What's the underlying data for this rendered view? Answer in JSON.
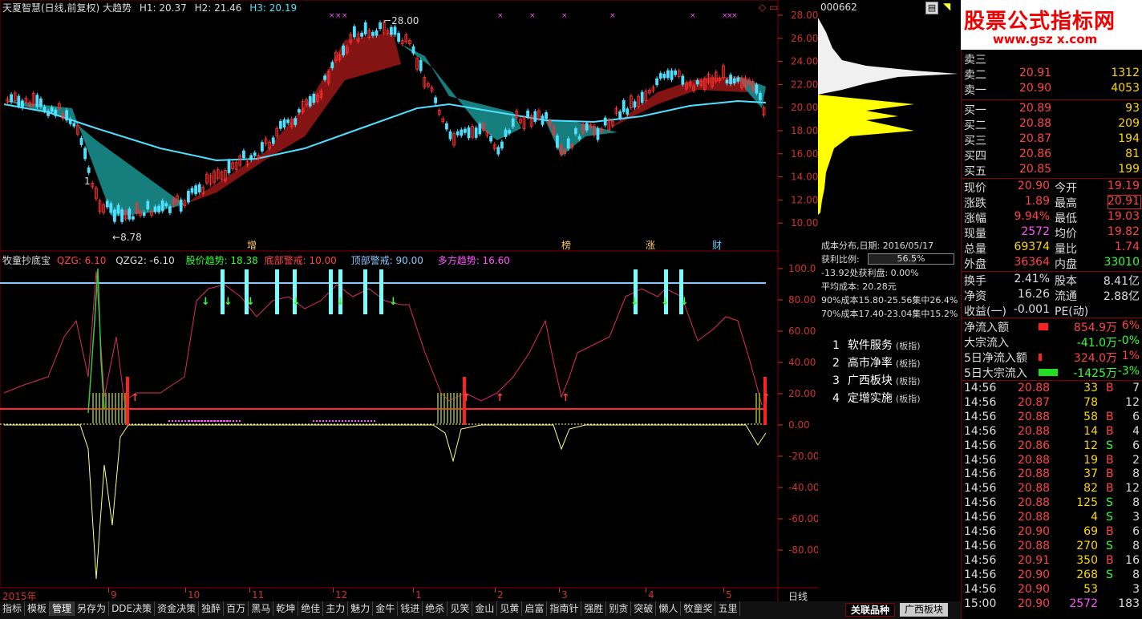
{
  "header": {
    "stock": "天夏智慧(日线,前复权)",
    "indicator": "大趋势",
    "h1": "H1: 20.37",
    "h2": "H2: 21.46",
    "h3": "H3: 20.19",
    "code": "000662"
  },
  "sub_header": {
    "name": "牧童抄底宝",
    "qzg": "QZG: 6.10",
    "qzg2": "QZG2: -6.10",
    "trend": "股价趋势: 18.38",
    "bottom": "底部警戒: 10.00",
    "top": "顶部警戒: 90.00",
    "multi": "多方趋势: 16.60"
  },
  "price_axis": [
    "28.00",
    "26.00",
    "24.00",
    "22.00",
    "20.00",
    "18.00",
    "16.00",
    "14.00",
    "12.00",
    "10.00"
  ],
  "ind_axis": [
    "100.0",
    "80.00",
    "60.00",
    "40.00",
    "20.00",
    "0.00",
    "-20.00",
    "-40.00",
    "-60.00",
    "-80.00"
  ],
  "annotations": {
    "high": "28.00",
    "low": "8.78",
    "marks": [
      "增",
      "榜",
      "涨",
      "财"
    ]
  },
  "time_axis": {
    "labels": [
      "2015年",
      "9",
      "10",
      "11",
      "12",
      "1",
      "2",
      "3",
      "4",
      "5"
    ],
    "period": "日线"
  },
  "cost": {
    "title": "成本分布,日期: 2016/05/17",
    "profit_label": "获利比例:",
    "profit_value": "56.5%",
    "line1": "-13.92处获利盘: 0.00%",
    "line2": "平均成本: 20.28元",
    "line3": "90%成本15.80-25.56集中26.4%",
    "line4": "70%成本17.40-23.04集中15.2%"
  },
  "sectors": [
    {
      "n": "1",
      "name": "软件服务",
      "tag": "(板指)"
    },
    {
      "n": "2",
      "name": "高市净率",
      "tag": "(板指)"
    },
    {
      "n": "3",
      "name": "广西板块",
      "tag": "(板指)"
    },
    {
      "n": "4",
      "name": "定增实施",
      "tag": "(板指)"
    }
  ],
  "logo": {
    "main": "股票公式指标网",
    "sub": "www.gsz x.com"
  },
  "order_book": {
    "sell": [
      {
        "label": "卖三",
        "price": "",
        "vol": ""
      },
      {
        "label": "卖二",
        "price": "20.91",
        "vol": "1312"
      },
      {
        "label": "卖一",
        "price": "20.90",
        "vol": "4053"
      }
    ],
    "buy": [
      {
        "label": "买一",
        "price": "20.89",
        "vol": "93"
      },
      {
        "label": "买二",
        "price": "20.88",
        "vol": "209"
      },
      {
        "label": "买三",
        "price": "20.87",
        "vol": "194"
      },
      {
        "label": "买四",
        "price": "20.86",
        "vol": "81"
      },
      {
        "label": "买五",
        "price": "20.85",
        "vol": "199"
      }
    ]
  },
  "stats": [
    {
      "l1": "现价",
      "v1": "20.90",
      "c1": "red",
      "l2": "今开",
      "v2": "19.19",
      "c2": "red"
    },
    {
      "l1": "涨跌",
      "v1": "1.89",
      "c1": "red",
      "l2": "最高",
      "v2": "20.91",
      "c2": "red"
    },
    {
      "l1": "涨幅",
      "v1": "9.94%",
      "c1": "red",
      "l2": "最低",
      "v2": "19.03",
      "c2": "red"
    },
    {
      "l1": "现量",
      "v1": "2572",
      "c1": "pink",
      "l2": "均价",
      "v2": "19.82",
      "c2": "red"
    },
    {
      "l1": "总量",
      "v1": "69374",
      "c1": "yellow",
      "l2": "量比",
      "v2": "1.74",
      "c2": "red"
    },
    {
      "l1": "外盘",
      "v1": "36364",
      "c1": "red",
      "l2": "内盘",
      "v2": "33010",
      "c2": "green"
    }
  ],
  "stats2": [
    {
      "l1": "换手",
      "v1": "2.41%",
      "l2": "股本",
      "v2": "8.41亿"
    },
    {
      "l1": "净资",
      "v1": "16.26",
      "l2": "流通",
      "v2": "2.88亿"
    },
    {
      "l1": "收益(一)",
      "v1": "-0.001",
      "l2": "PE(动)",
      "v2": ""
    }
  ],
  "flows": [
    {
      "label": "净流入额",
      "val": "854.9万",
      "pct": "6%",
      "c": "red",
      "bar": "red"
    },
    {
      "label": "大宗流入",
      "val": "-41.0万",
      "pct": "-0%",
      "c": "green",
      "bar": ""
    },
    {
      "label": "5日净流入额",
      "val": "324.0万",
      "pct": "1%",
      "c": "red",
      "bar": "red"
    },
    {
      "label": "5日大宗流入",
      "val": "-1425万",
      "pct": "-3%",
      "c": "green",
      "bar": "green"
    }
  ],
  "ticks": [
    {
      "t": "14:56",
      "p": "20.88",
      "v": "33",
      "s": "B",
      "n": "7"
    },
    {
      "t": "14:56",
      "p": "20.87",
      "v": "78",
      "s": "",
      "n": "12"
    },
    {
      "t": "14:56",
      "p": "20.88",
      "v": "58",
      "s": "B",
      "n": "6"
    },
    {
      "t": "14:56",
      "p": "20.88",
      "v": "14",
      "s": "B",
      "n": "4"
    },
    {
      "t": "14:56",
      "p": "20.86",
      "v": "12",
      "s": "S",
      "n": "6"
    },
    {
      "t": "14:56",
      "p": "20.88",
      "v": "19",
      "s": "B",
      "n": "2"
    },
    {
      "t": "14:56",
      "p": "20.88",
      "v": "37",
      "s": "B",
      "n": "8"
    },
    {
      "t": "14:56",
      "p": "20.88",
      "v": "82",
      "s": "B",
      "n": "12"
    },
    {
      "t": "14:56",
      "p": "20.88",
      "v": "125",
      "s": "S",
      "n": "8"
    },
    {
      "t": "14:56",
      "p": "20.88",
      "v": "4",
      "s": "S",
      "n": "3"
    },
    {
      "t": "14:56",
      "p": "20.90",
      "v": "69",
      "s": "B",
      "n": "6"
    },
    {
      "t": "14:56",
      "p": "20.88",
      "v": "270",
      "s": "S",
      "n": "8"
    },
    {
      "t": "14:56",
      "p": "20.91",
      "v": "350",
      "s": "B",
      "n": "16"
    },
    {
      "t": "14:56",
      "p": "20.90",
      "v": "268",
      "s": "S",
      "n": "8"
    },
    {
      "t": "14:56",
      "p": "20.90",
      "v": "53",
      "s": "",
      "n": "3"
    },
    {
      "t": "15:00",
      "p": "20.90",
      "v": "2572",
      "s": "",
      "n": "183"
    }
  ],
  "tabs": [
    "指标",
    "模板",
    "管理",
    "另存为",
    "DDE决策",
    "资金决策",
    "独醉",
    "百万",
    "黑马",
    "乾坤",
    "绝佳",
    "主力",
    "魅力",
    "金牛",
    "钱进",
    "绝杀",
    "见笑",
    "金山",
    "见黄",
    "启富",
    "指南针",
    "强胜",
    "别贪",
    "突破",
    "懒人",
    "牧童奖",
    "五里"
  ],
  "bottom_tabs": {
    "a": "关联品种",
    "b": "广西板块"
  }
}
